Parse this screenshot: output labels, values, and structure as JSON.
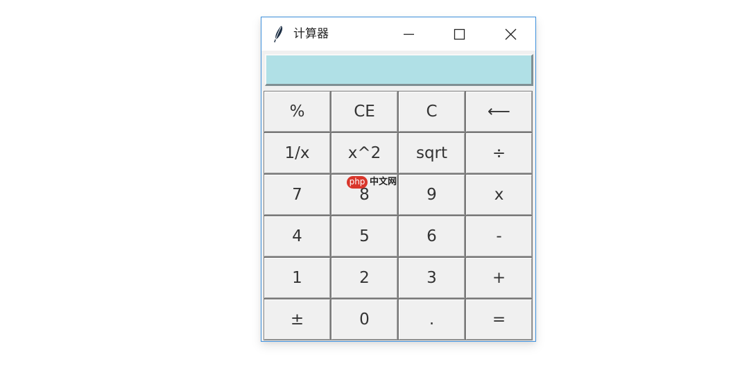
{
  "window": {
    "title": "计算器"
  },
  "display": {
    "value": ""
  },
  "keypad": {
    "rows": [
      [
        "%",
        "CE",
        "C",
        "⟵"
      ],
      [
        "1/x",
        "x^2",
        "sqrt",
        "÷"
      ],
      [
        "7",
        "8",
        "9",
        "x"
      ],
      [
        "4",
        "5",
        "6",
        "-"
      ],
      [
        "1",
        "2",
        "3",
        "+"
      ],
      [
        "±",
        "0",
        ".",
        "="
      ]
    ]
  },
  "watermark": {
    "badge": "php",
    "text": "中文网"
  },
  "colors": {
    "display_bg": "#b0e0e6",
    "window_border": "#3c8fdc",
    "button_face": "#f0f0f0",
    "watermark_red": "#d9362b"
  },
  "icons": {
    "app": "feather-icon",
    "minimize": "minimize-icon",
    "maximize": "maximize-icon",
    "close": "close-icon"
  }
}
